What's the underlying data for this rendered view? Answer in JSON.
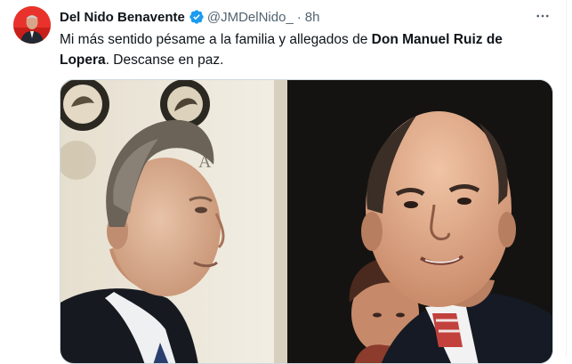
{
  "tweet": {
    "author_name": "Del Nido Benavente",
    "handle": "@JMDelNido_",
    "separator": "·",
    "time": "8h",
    "verified": true,
    "more_icon": "more-horizontal-icon",
    "text_part1": "Mi más sentido pésame a la familia y allegados de ",
    "text_bold": "Don Manuel Ruiz de Lopera",
    "text_part2": ". Descanse en paz."
  },
  "colors": {
    "verified_blue": "#1d9bf0",
    "secondary_text": "#536471",
    "avatar_bg": "#e8322b"
  }
}
